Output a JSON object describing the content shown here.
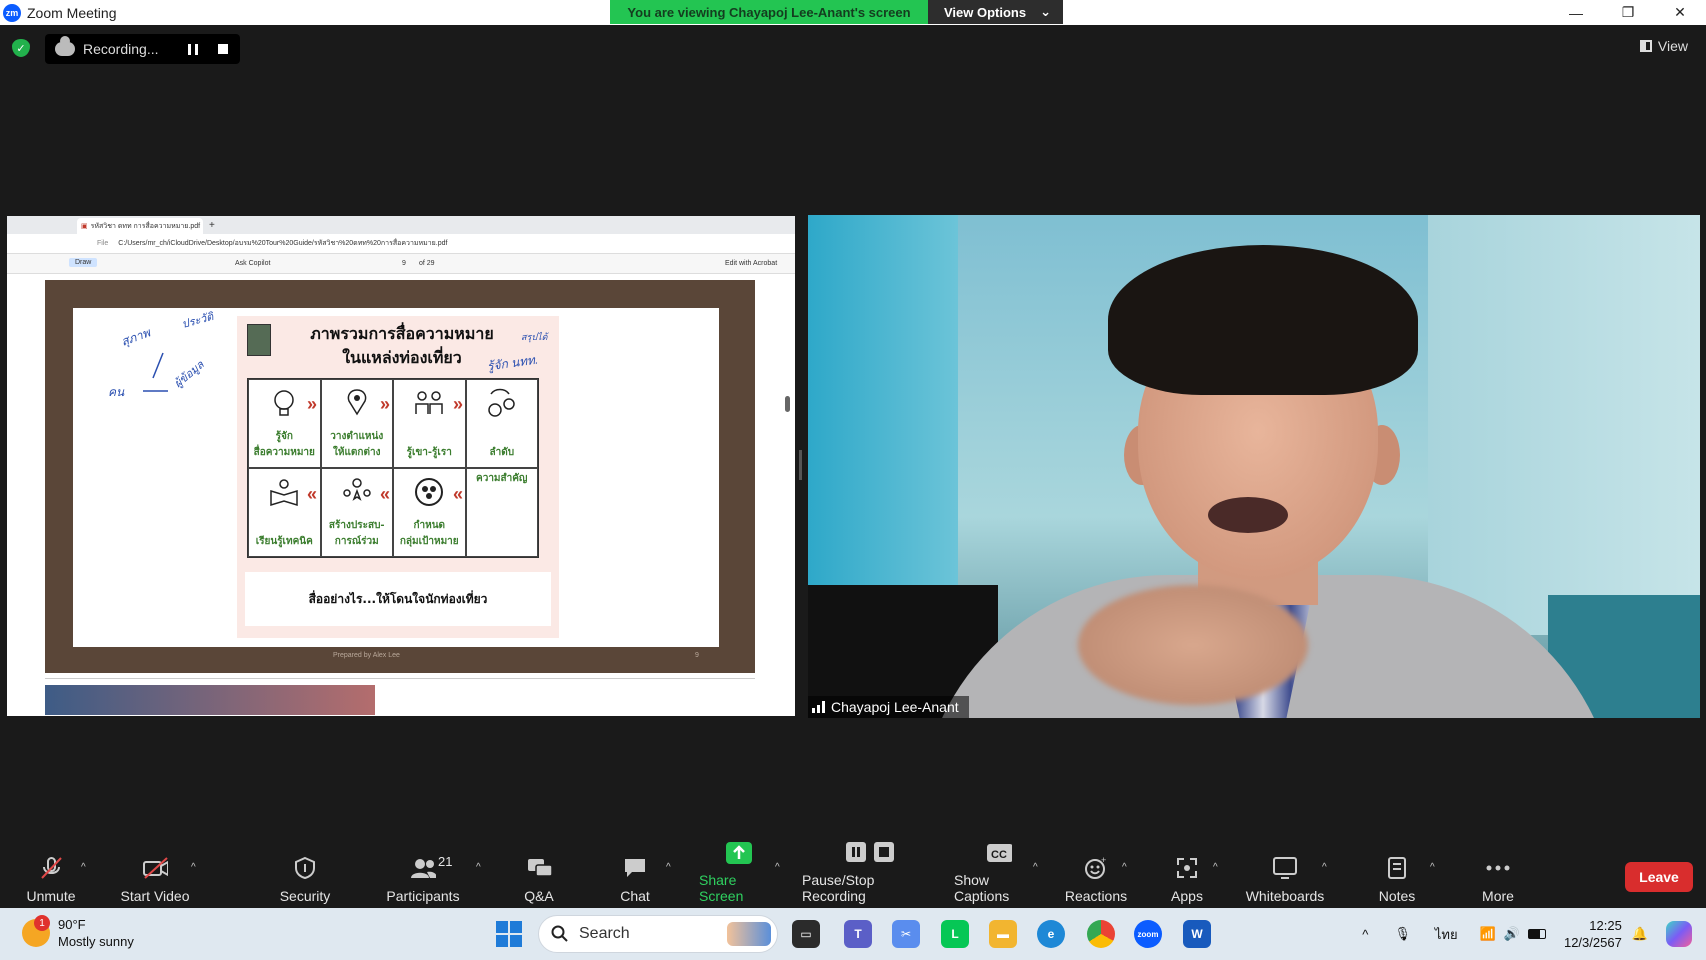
{
  "window": {
    "title": "Zoom Meeting",
    "viewing_banner": "You are viewing Chayapoj Lee-Anant's screen",
    "view_options": "View Options",
    "minimize": "—",
    "restore": "❐",
    "close": "✕"
  },
  "recording": {
    "status": "Recording...",
    "view_label": "View"
  },
  "browser": {
    "tab_title": "รหัสวิชา ดทท การสื่อความหมาย.pdf",
    "url_prefix": "File",
    "url": "C:/Users/mr_ch/iCloudDrive/Desktop/อบรม%20Tour%20Guide/รหัสวิชา%20ดทท%20การสื่อความหมาย.pdf",
    "draw": "Draw",
    "ask_copilot": "Ask Copilot",
    "page_current": "9",
    "page_total": "of 29",
    "edit_acrobat": "Edit with Acrobat"
  },
  "slide": {
    "title_line1": "ภาพรวมการสื่อความหมาย",
    "title_line2": "ในแหล่งท่องเที่ยว",
    "note": "สรุปได้",
    "cells": [
      {
        "line1": "รู้จัก",
        "line2": "สื่อความหมาย"
      },
      {
        "line1": "วางตำแหน่ง",
        "line2": "ให้แตกต่าง"
      },
      {
        "line1": "รู้เขา-รู้เรา",
        "line2": ""
      },
      {
        "line1": "",
        "line2": "ลำดับ"
      },
      {
        "line1": "เรียนรู้เทคนิค",
        "line2": ""
      },
      {
        "line1": "สร้างประสบ-",
        "line2": "การณ์ร่วม"
      },
      {
        "line1": "กำหนด",
        "line2": "กลุ่มเป้าหมาย"
      },
      {
        "line1": "ความสำคัญ",
        "line2": ""
      }
    ],
    "bottom_text": "สื่ออย่างไร...ให้โดนใจนักท่องเที่ยว",
    "prepared_by": "Prepared by Alex Lee",
    "page_no": "9",
    "handwriting": [
      "สุภาพ",
      "ประวัติ",
      "คน",
      "ผู้ข้อมูล",
      "รู้จัก นทท."
    ]
  },
  "participant": {
    "name": "Chayapoj Lee-Anant"
  },
  "toolbar": {
    "unmute": "Unmute",
    "start_video": "Start Video",
    "security": "Security",
    "participants": "Participants",
    "participant_count": "21",
    "qa": "Q&A",
    "chat": "Chat",
    "share_screen": "Share Screen",
    "pause_stop": "Pause/Stop Recording",
    "show_captions": "Show Captions",
    "reactions": "Reactions",
    "apps": "Apps",
    "whiteboards": "Whiteboards",
    "notes": "Notes",
    "more": "More",
    "leave": "Leave",
    "colors": {
      "share_green": "#23c552",
      "leave_red": "#d92d2d"
    }
  },
  "taskbar": {
    "weather_temp": "90°F",
    "weather_desc": "Mostly sunny",
    "weather_badge": "1",
    "search": "Search",
    "lang": "ไทย",
    "time": "12:25",
    "date": "12/3/2567"
  }
}
